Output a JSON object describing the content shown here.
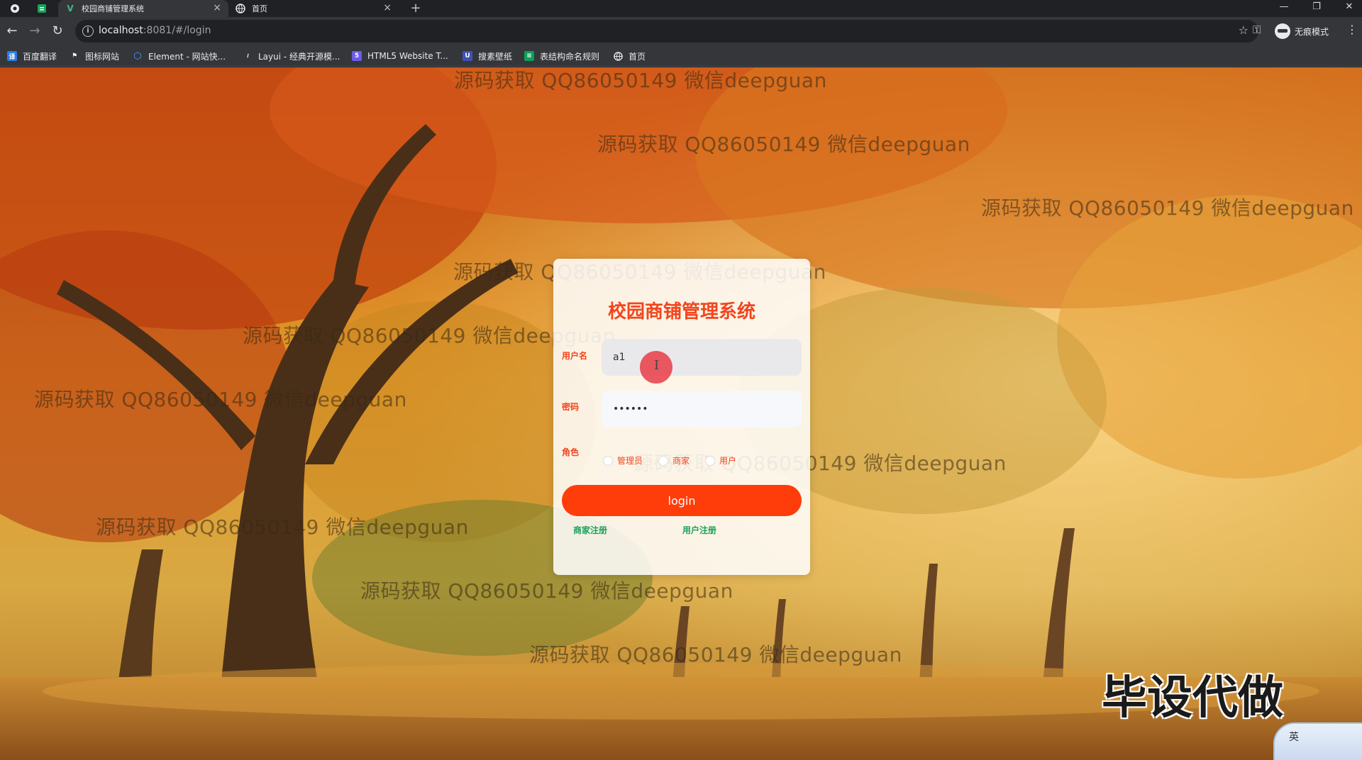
{
  "browser": {
    "tabs": [
      {
        "title": "校园商铺管理系统",
        "active": true
      },
      {
        "title": "首页",
        "active": false
      }
    ],
    "address_host": "localhost",
    "address_path": ":8081/#/login",
    "incognito_label": "无痕模式",
    "bookmarks": [
      {
        "label": "百度翻译",
        "icon": "translate-icon",
        "color": "#2b7be4"
      },
      {
        "label": "图标网站",
        "icon": "flag-icon",
        "color": "#4a4b4f"
      },
      {
        "label": "Element - 网站快...",
        "icon": "element-icon",
        "color": "#409eff"
      },
      {
        "label": "Layui - 经典开源模...",
        "icon": "layui-icon",
        "color": "#4a4b4f"
      },
      {
        "label": "HTML5 Website T...",
        "icon": "html5-icon",
        "color": "#6c5ce7"
      },
      {
        "label": "搜素壁纸",
        "icon": "wallpaper-icon",
        "color": "#3f51b5"
      },
      {
        "label": "表结构命名规则",
        "icon": "sheet-icon",
        "color": "#0f9d58"
      },
      {
        "label": "首页",
        "icon": "globe-icon",
        "color": "#4a4b4f"
      }
    ]
  },
  "watermark_text": "源码获取 QQ86050149 微信deepguan",
  "login": {
    "title": "校园商铺管理系统",
    "username_label": "用户名",
    "username_value": "a1",
    "password_label": "密码",
    "password_value": "••••••",
    "role_label": "角色",
    "roles": [
      "管理员",
      "商家",
      "用户"
    ],
    "login_button": "login",
    "merchant_register": "商家注册",
    "user_register": "用户注册"
  },
  "stamp_text": "毕设代做",
  "ime_label": "英",
  "colors": {
    "accent": "#f2451d",
    "button": "#ff3d0a",
    "link": "#1aa05a"
  }
}
